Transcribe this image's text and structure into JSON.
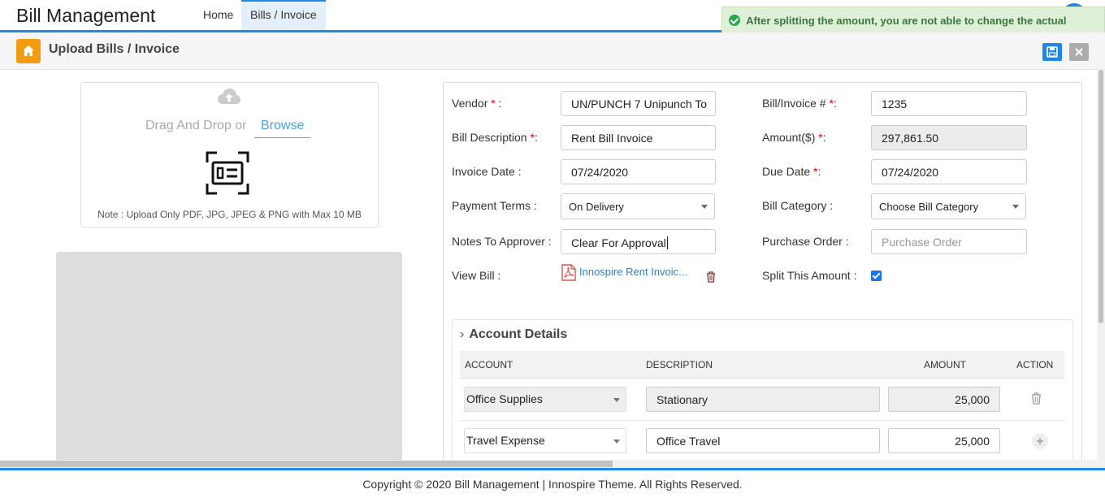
{
  "app": {
    "title": "Bill Management"
  },
  "nav": {
    "items": [
      {
        "label": "Home"
      },
      {
        "label": "Bills / Invoice"
      }
    ]
  },
  "toast": {
    "message": "After splitting the amount, you are not able to change the actual amount",
    "color": "#3c763d"
  },
  "header": {
    "title": "Upload Bills / Invoice"
  },
  "upload": {
    "drag_text": "Drag And Drop or",
    "browse_label": "Browse",
    "note": "Note : Upload Only PDF, JPG, JPEG & PNG with Max 10 MB"
  },
  "form": {
    "vendor": {
      "label": "Vendor",
      "required_mark": "*",
      "suffix": " :",
      "value": "UN/PUNCH 7 Unipunch To"
    },
    "bill_no": {
      "label": "Bill/Invoice #",
      "required_mark": "*",
      "suffix": ":",
      "value": "1235"
    },
    "description": {
      "label": "Bill Description",
      "required_mark": "*",
      "suffix": ":",
      "value": "Rent Bill Invoice"
    },
    "amount": {
      "label": "Amount($)",
      "required_mark": "*",
      "suffix": ":",
      "value": "297,861.50"
    },
    "invoice_date": {
      "label": "Invoice Date :",
      "value": "07/24/2020"
    },
    "due_date": {
      "label": "Due Date",
      "required_mark": "*",
      "suffix": ":",
      "value": "07/24/2020"
    },
    "payment_terms": {
      "label": "Payment Terms :",
      "value": "On Delivery"
    },
    "bill_category": {
      "label": "Bill Category :",
      "value": "Choose Bill Category"
    },
    "notes": {
      "label": "Notes To Approver :",
      "value": "Clear For Approval"
    },
    "purchase_order": {
      "label": "Purchase Order :",
      "placeholder": "Purchase Order"
    },
    "view_bill": {
      "label": "View Bill :",
      "file_name": "Innospire Rent Invoic..."
    },
    "split": {
      "label": "Split This Amount :",
      "checked": true
    }
  },
  "accounts": {
    "title": "Account Details",
    "columns": {
      "account": "ACCOUNT",
      "description": "DESCRIPTION",
      "amount": "AMOUNT",
      "action": "ACTION"
    },
    "rows": [
      {
        "account": "Office Supplies",
        "description": "Stationary",
        "amount": "25,000"
      },
      {
        "account": "Travel Expense",
        "description": "Office Travel",
        "amount": "25,000"
      }
    ]
  },
  "footer": {
    "text": "Copyright © 2020 Bill Management | Innospire Theme. All Rights Reserved."
  },
  "colors": {
    "accent": "#1e88e5",
    "home_button": "#f39c12",
    "required": "#ee0000",
    "link": "#3a7ec1"
  }
}
